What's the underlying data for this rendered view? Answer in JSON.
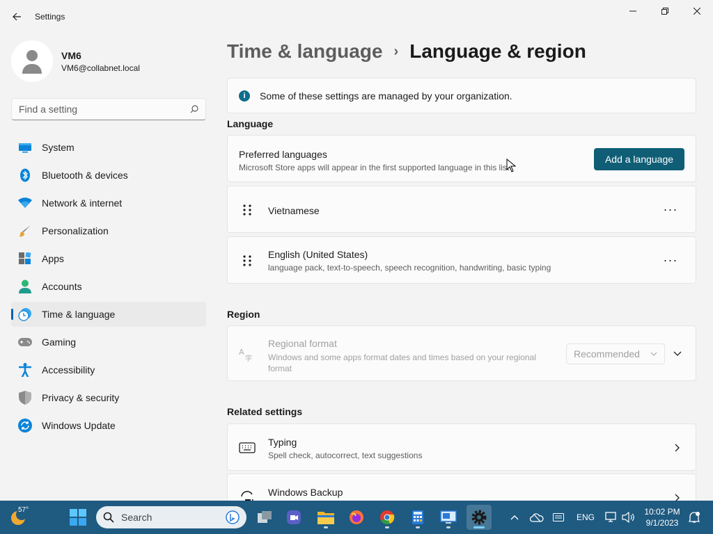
{
  "window": {
    "title": "Settings"
  },
  "profile": {
    "name": "VM6",
    "email": "VM6@collabnet.local"
  },
  "search": {
    "placeholder": "Find a setting"
  },
  "sidebar": {
    "items": [
      {
        "label": "System",
        "icon": "system-icon"
      },
      {
        "label": "Bluetooth & devices",
        "icon": "bluetooth-icon"
      },
      {
        "label": "Network & internet",
        "icon": "wifi-icon"
      },
      {
        "label": "Personalization",
        "icon": "brush-icon"
      },
      {
        "label": "Apps",
        "icon": "apps-icon"
      },
      {
        "label": "Accounts",
        "icon": "accounts-icon"
      },
      {
        "label": "Time & language",
        "icon": "time-language-icon",
        "active": true
      },
      {
        "label": "Gaming",
        "icon": "gamepad-icon"
      },
      {
        "label": "Accessibility",
        "icon": "accessibility-icon"
      },
      {
        "label": "Privacy & security",
        "icon": "shield-icon"
      },
      {
        "label": "Windows Update",
        "icon": "update-icon"
      }
    ]
  },
  "breadcrumb": {
    "parent": "Time & language",
    "separator": "›",
    "current": "Language & region"
  },
  "info": {
    "text": "Some of these settings are managed by your organization."
  },
  "language": {
    "section_title": "Language",
    "preferred": {
      "title": "Preferred languages",
      "subtitle": "Microsoft Store apps will appear in the first supported language in this list",
      "button": "Add a language"
    },
    "languages": [
      {
        "name": "Vietnamese",
        "detail": ""
      },
      {
        "name": "English (United States)",
        "detail": "language pack, text-to-speech, speech recognition, handwriting, basic typing"
      }
    ],
    "more_label": "···"
  },
  "region": {
    "section_title": "Region",
    "regional_format": {
      "title": "Regional format",
      "subtitle": "Windows and some apps format dates and times based on your regional format",
      "value": "Recommended"
    }
  },
  "related": {
    "section_title": "Related settings",
    "items": [
      {
        "title": "Typing",
        "subtitle": "Spell check, autocorrect, text suggestions",
        "icon": "keyboard-icon"
      },
      {
        "title": "Windows Backup",
        "subtitle": "",
        "icon": "backup-icon"
      }
    ]
  },
  "taskbar": {
    "weather_temp": "57°",
    "search_placeholder": "Search",
    "language_indicator": "ENG",
    "time": "10:02 PM",
    "date": "9/1/2023"
  },
  "colors": {
    "accent": "#005fb8",
    "button": "#0f5e76",
    "taskbar": "#1f5a80"
  }
}
